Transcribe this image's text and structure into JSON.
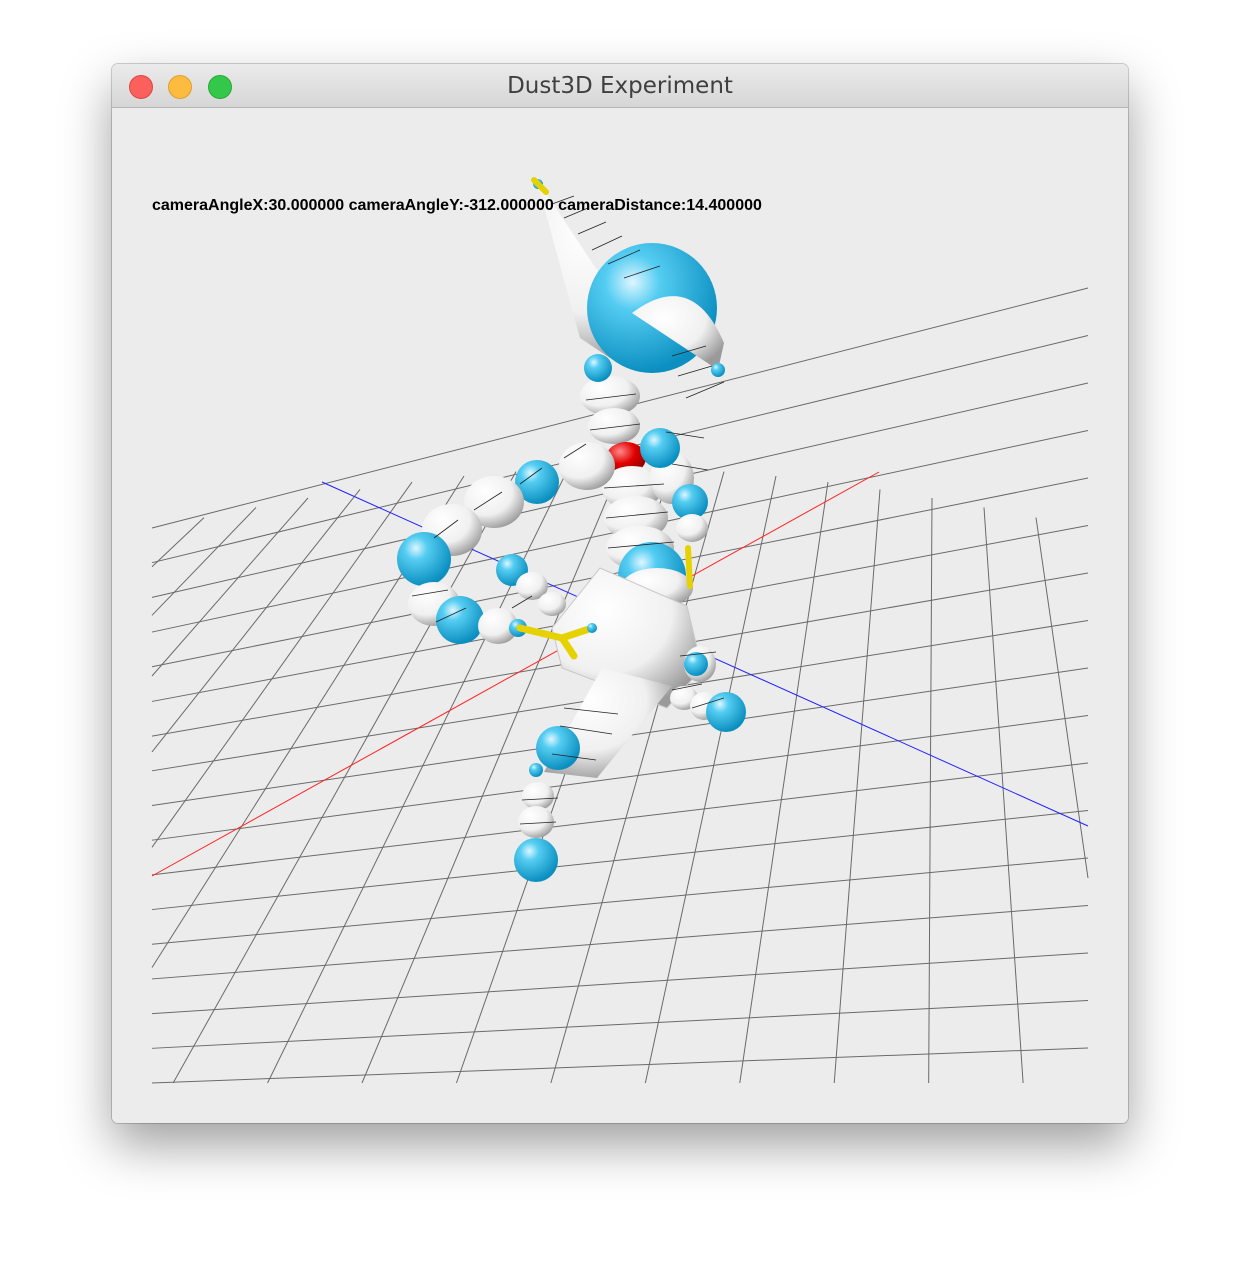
{
  "window": {
    "title": "Dust3D Experiment"
  },
  "viewport": {
    "camera_info": "cameraAngleX:30.000000 cameraAngleY:-312.000000 cameraDistance:14.400000"
  },
  "colors": {
    "grid": "#6a6a6a",
    "x_axis": "#ff0000",
    "z_axis": "#0000ff",
    "joint": "#1ab0e0",
    "bone": "#ffffff",
    "selected_joint": "#e00000",
    "end_marker": "#f0e020",
    "background": "#ececec"
  }
}
